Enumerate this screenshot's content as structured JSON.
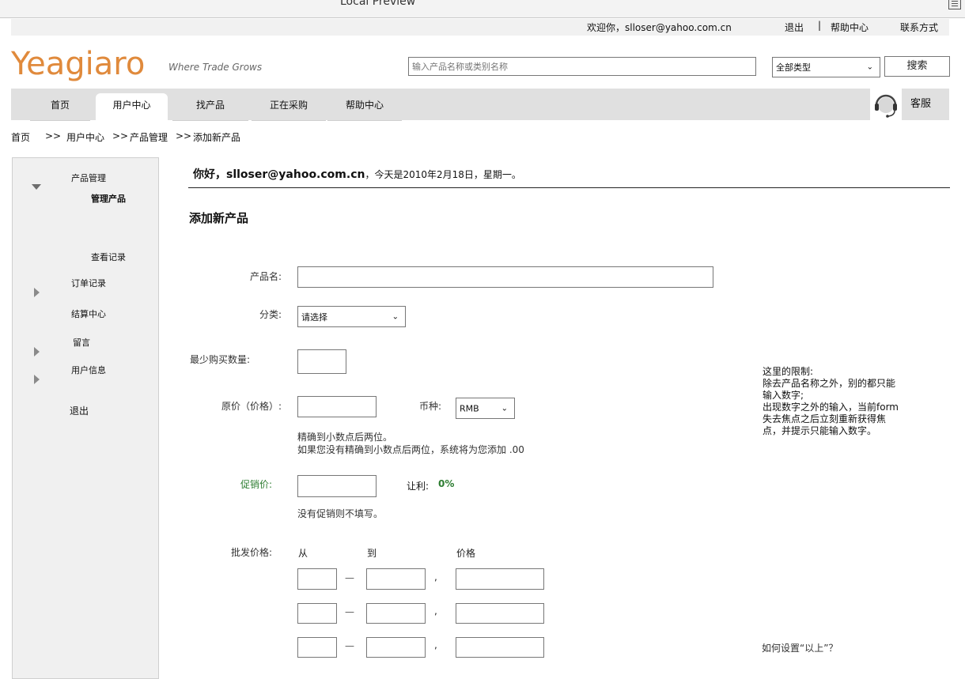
{
  "window": {
    "title": "Local Preview"
  },
  "topbar": {
    "welcome": "欢迎你，slloser@yahoo.com.cn",
    "logout": "退出",
    "separator": "|",
    "help": "帮助中心",
    "contact": "联系方式"
  },
  "header": {
    "logo": "Yeagiaro",
    "slogan": "Where Trade Grows",
    "search_placeholder": "输入产品名称或类别名称",
    "category_value": "全部类型",
    "search_button": "搜索"
  },
  "nav": {
    "tabs": [
      {
        "label": "首页"
      },
      {
        "label": "用户中心",
        "active": true
      },
      {
        "label": "找产品"
      },
      {
        "label": "正在采购"
      },
      {
        "label": "帮助中心"
      }
    ],
    "service_label": "客服"
  },
  "breadcrumb": [
    "首页",
    ">>",
    "用户中心",
    ">>",
    "产品管理",
    ">>",
    "添加新产品"
  ],
  "sidebar": {
    "product_mgmt": "产品管理",
    "overlap_label": "管理产品",
    "view_records": "查看记录",
    "orders": "订单记录",
    "settlement": "结算中心",
    "messages": "留言",
    "user_info": "用户信息",
    "logout": "退出"
  },
  "main": {
    "greeting_user": "你好，slloser@yahoo.com.cn",
    "greeting_rest": "，今天是2010年2月18日，星期一。",
    "section_title": "添加新产品",
    "fields": {
      "product_name": "产品名:",
      "category": "分类:",
      "category_value": "请选择",
      "min_qty": "最少购买数量:",
      "orig_price": "原价（价格）:",
      "currency": "币种:",
      "currency_value": "RMB",
      "price_hint_1": "精确到小数点后两位。",
      "price_hint_2": "如果您没有精确到小数点后两位，系统将为您添加 .00",
      "promo_price": "促销价:",
      "discount_label": "让利:",
      "discount_value": "0%",
      "promo_hint": "没有促销则不填写。",
      "wholesale": "批发价格:",
      "from": "从",
      "to": "到",
      "price": "价格",
      "dash": "—",
      "comma": ","
    },
    "note": {
      "line1": "这里的限制:",
      "line2": "除去产品名称之外，别的都只能",
      "line3": "输入数字;",
      "line4": "出现数字之外的输入，当前form",
      "line5": "失去焦点之后立刻重新获得焦",
      "line6": "点，并提示只能输入数字。"
    },
    "how_to_set": "如何设置“以上”？"
  },
  "colors": {
    "logo": "#e08a3c",
    "promo_label": "#2e7d32",
    "discount_value": "#2e7d32",
    "navbar": "#e0e0e0",
    "sidebar": "#f0f0f0"
  }
}
